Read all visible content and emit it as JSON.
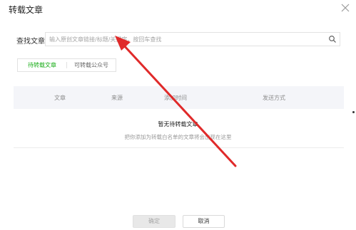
{
  "dialog": {
    "title": "转载文章"
  },
  "search": {
    "label": "查找文章",
    "placeholder": "输入原创文章链接/标题/关键字，按回车查找",
    "value": ""
  },
  "tabs": [
    {
      "label": "待转载文章",
      "active": true
    },
    {
      "label": "可转载公众号",
      "active": false
    }
  ],
  "table": {
    "columns": [
      "文章",
      "来源",
      "添加时间",
      "发送方式"
    ]
  },
  "empty_state": {
    "title": "暂无待转载文章",
    "description": "把你添加为转载白名单的文章将会出现在这里"
  },
  "buttons": {
    "confirm": "确定",
    "cancel": "取消"
  },
  "colors": {
    "accent": "#1aad19",
    "annotation_arrow": "#e02a2a",
    "table_header_bg": "#f4f5f9"
  }
}
